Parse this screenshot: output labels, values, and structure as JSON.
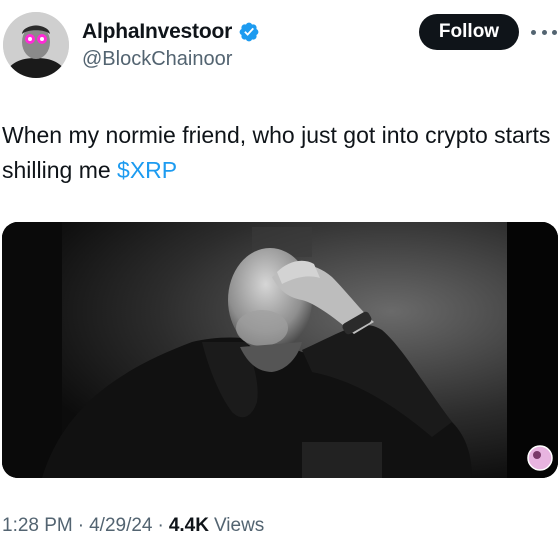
{
  "author": {
    "display_name": "AlphaInvestoor",
    "handle": "@BlockChainoor",
    "verified": true,
    "avatar_icon": "profile-avatar"
  },
  "actions": {
    "follow_label": "Follow",
    "more_icon": "more-horizontal-icon"
  },
  "tweet": {
    "text_main": "When my normie friend, who just got into crypto starts shilling me ",
    "cashtag": "$XRP"
  },
  "media": {
    "type": "video-thumbnail",
    "icon": "sticker-avatar-icon"
  },
  "meta": {
    "time": "1:28 PM",
    "sep1": "·",
    "date": "4/29/24",
    "sep2": "·",
    "views_count": "4.4K",
    "views_label": "Views"
  },
  "colors": {
    "text": "#0f1419",
    "secondary": "#536471",
    "link": "#1d9bf0",
    "verified": "#1d9bf0",
    "button_bg": "#0f1419"
  }
}
